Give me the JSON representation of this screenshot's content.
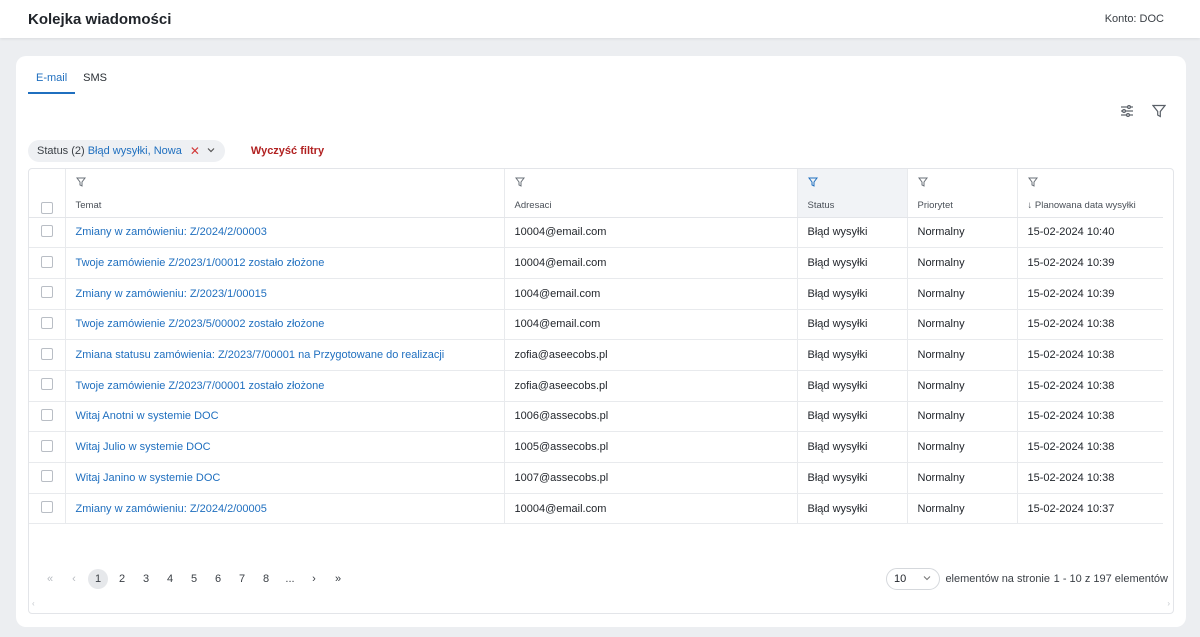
{
  "header": {
    "title": "Kolejka wiadomości",
    "account": "Konto: DOC"
  },
  "tabs": [
    {
      "label": "E-mail"
    },
    {
      "label": "SMS"
    }
  ],
  "filter_chip": {
    "label": "Status (2)",
    "value": "Błąd wysyłki, Nowa"
  },
  "clear_filters": "Wyczyść filtry",
  "columns": {
    "subject": "Temat",
    "recipients": "Adresaci",
    "status": "Status",
    "priority": "Priorytet",
    "scheduled": "↓ Planowana data wysyłki"
  },
  "rows": [
    {
      "subject": "Zmiany w zamówieniu: Z/2024/2/00003",
      "recipient": "10004@email.com",
      "status": "Błąd wysyłki",
      "priority": "Normalny",
      "date": "15-02-2024 10:40"
    },
    {
      "subject": "Twoje zamówienie Z/2023/1/00012 zostało złożone",
      "recipient": "10004@email.com",
      "status": "Błąd wysyłki",
      "priority": "Normalny",
      "date": "15-02-2024 10:39"
    },
    {
      "subject": "Zmiany w zamówieniu: Z/2023/1/00015",
      "recipient": "1004@email.com",
      "status": "Błąd wysyłki",
      "priority": "Normalny",
      "date": "15-02-2024 10:39"
    },
    {
      "subject": "Twoje zamówienie Z/2023/5/00002 zostało złożone",
      "recipient": "1004@email.com",
      "status": "Błąd wysyłki",
      "priority": "Normalny",
      "date": "15-02-2024 10:38"
    },
    {
      "subject": "Zmiana statusu zamówienia: Z/2023/7/00001 na Przygotowane do realizacji",
      "recipient": "zofia@aseecobs.pl",
      "status": "Błąd wysyłki",
      "priority": "Normalny",
      "date": "15-02-2024 10:38"
    },
    {
      "subject": "Twoje zamówienie Z/2023/7/00001 zostało złożone",
      "recipient": "zofia@aseecobs.pl",
      "status": "Błąd wysyłki",
      "priority": "Normalny",
      "date": "15-02-2024 10:38"
    },
    {
      "subject": "Witaj Anotni w systemie DOC",
      "recipient": "1006@assecobs.pl",
      "status": "Błąd wysyłki",
      "priority": "Normalny",
      "date": "15-02-2024 10:38"
    },
    {
      "subject": "Witaj Julio w systemie DOC",
      "recipient": "1005@assecobs.pl",
      "status": "Błąd wysyłki",
      "priority": "Normalny",
      "date": "15-02-2024 10:38"
    },
    {
      "subject": "Witaj Janino w systemie DOC",
      "recipient": "1007@assecobs.pl",
      "status": "Błąd wysyłki",
      "priority": "Normalny",
      "date": "15-02-2024 10:38"
    },
    {
      "subject": "Zmiany w zamówieniu: Z/2024/2/00005",
      "recipient": "10004@email.com",
      "status": "Błąd wysyłki",
      "priority": "Normalny",
      "date": "15-02-2024 10:37"
    }
  ],
  "pagination": {
    "first": "«",
    "prev": "‹",
    "pages": [
      "1",
      "2",
      "3",
      "4",
      "5",
      "6",
      "7",
      "8",
      "..."
    ],
    "next": "›",
    "last": "»",
    "page_size": "10",
    "page_size_label": "elementów na stronie",
    "range": "1 - 10 z 197 elementów"
  },
  "colors": {
    "accent": "#1f6fbf",
    "danger": "#b12121"
  },
  "icons": {
    "columns": "sliders-icon",
    "filter": "funnel-icon"
  }
}
